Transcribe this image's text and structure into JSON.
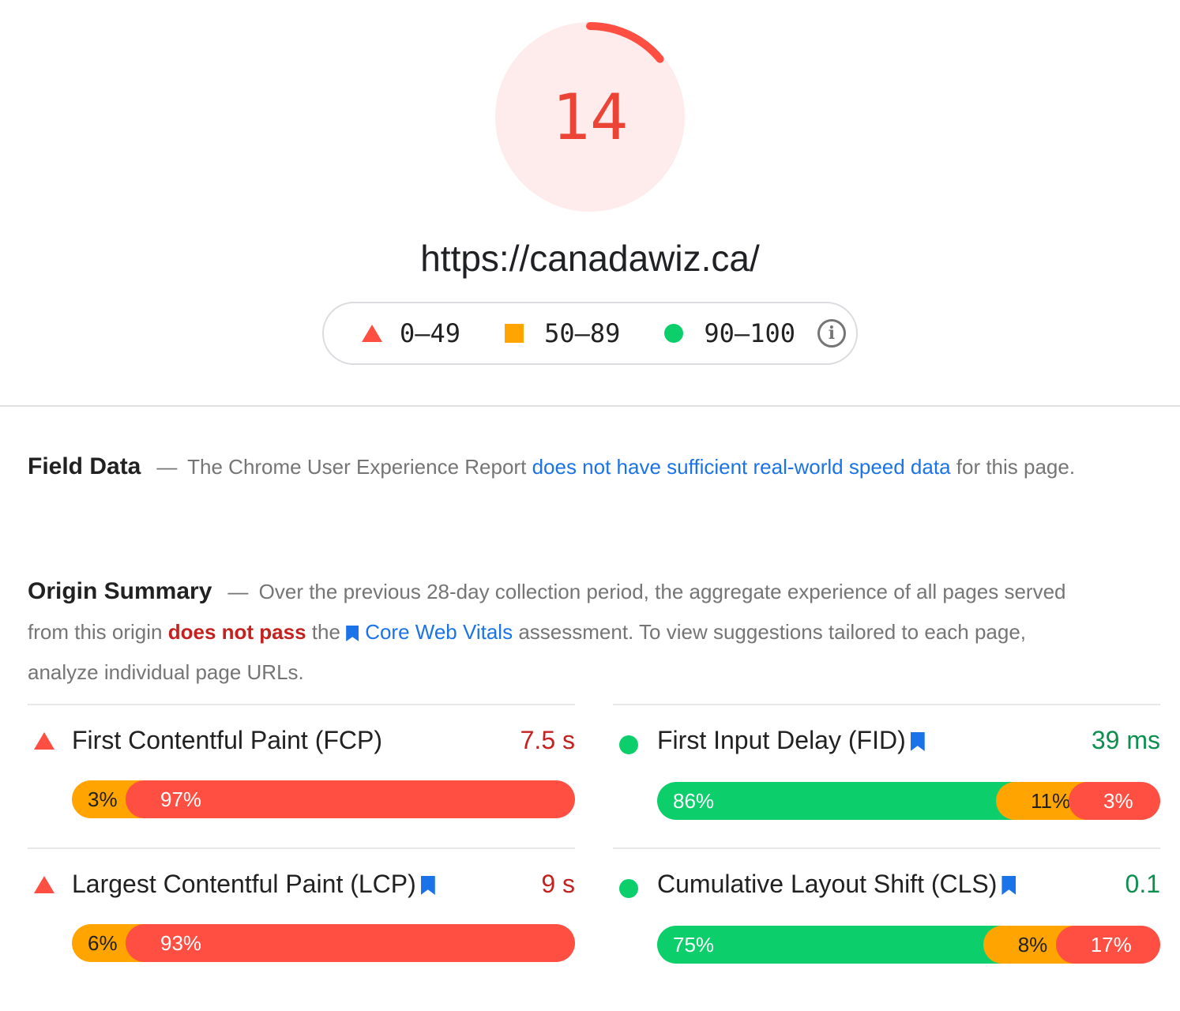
{
  "score": {
    "value": "14",
    "fraction": 0.14,
    "color": "#ff4e42"
  },
  "url": "https://canadawiz.ca/",
  "legend": {
    "ranges": [
      {
        "icon": "red-triangle-icon",
        "label": "0–49",
        "color": "#ff4e42"
      },
      {
        "icon": "orange-square-icon",
        "label": "50–89",
        "color": "#ffa400"
      },
      {
        "icon": "green-circle-icon",
        "label": "90–100",
        "color": "#0cce6b"
      }
    ],
    "info_icon": "info-icon"
  },
  "field_data": {
    "heading": "Field Data",
    "dash": "—",
    "text_before": "The Chrome User Experience Report",
    "link": "does not have sufficient real-world speed data",
    "text_after": "for this page."
  },
  "origin_summary": {
    "heading": "Origin Summary",
    "dash": "—",
    "text1": "Over the previous 28-day collection period, the aggregate experience of all pages served from this origin",
    "fail": "does not pass",
    "text2": "the",
    "link": "Core Web Vitals",
    "text3": "assessment. To view suggestions tailored to each page, analyze individual page URLs."
  },
  "metrics": [
    {
      "name": "First Contentful Paint (FCP)",
      "value": "7.5 s",
      "status": "fail",
      "value_color": "#c5221f",
      "core": false,
      "distribution": [
        {
          "label": "3%",
          "pct": 3,
          "cls": "o"
        },
        {
          "label": "97%",
          "pct": 97,
          "cls": "r"
        }
      ]
    },
    {
      "name": "First Input Delay (FID)",
      "value": "39 ms",
      "status": "pass",
      "value_color": "#0d904f",
      "core": true,
      "distribution": [
        {
          "label": "86%",
          "pct": 86,
          "cls": "g"
        },
        {
          "label": "11%",
          "pct": 11,
          "cls": "o"
        },
        {
          "label": "3%",
          "pct": 3,
          "cls": "r"
        }
      ]
    },
    {
      "name": "Largest Contentful Paint (LCP)",
      "value": "9 s",
      "status": "fail",
      "value_color": "#c5221f",
      "core": true,
      "distribution": [
        {
          "label": "6%",
          "pct": 6,
          "cls": "o"
        },
        {
          "label": "93%",
          "pct": 93,
          "cls": "r"
        }
      ]
    },
    {
      "name": "Cumulative Layout Shift (CLS)",
      "value": "0.1",
      "status": "pass",
      "value_color": "#0d904f",
      "core": true,
      "distribution": [
        {
          "label": "75%",
          "pct": 75,
          "cls": "g"
        },
        {
          "label": "8%",
          "pct": 8,
          "cls": "o"
        },
        {
          "label": "17%",
          "pct": 17,
          "cls": "r"
        }
      ]
    }
  ]
}
